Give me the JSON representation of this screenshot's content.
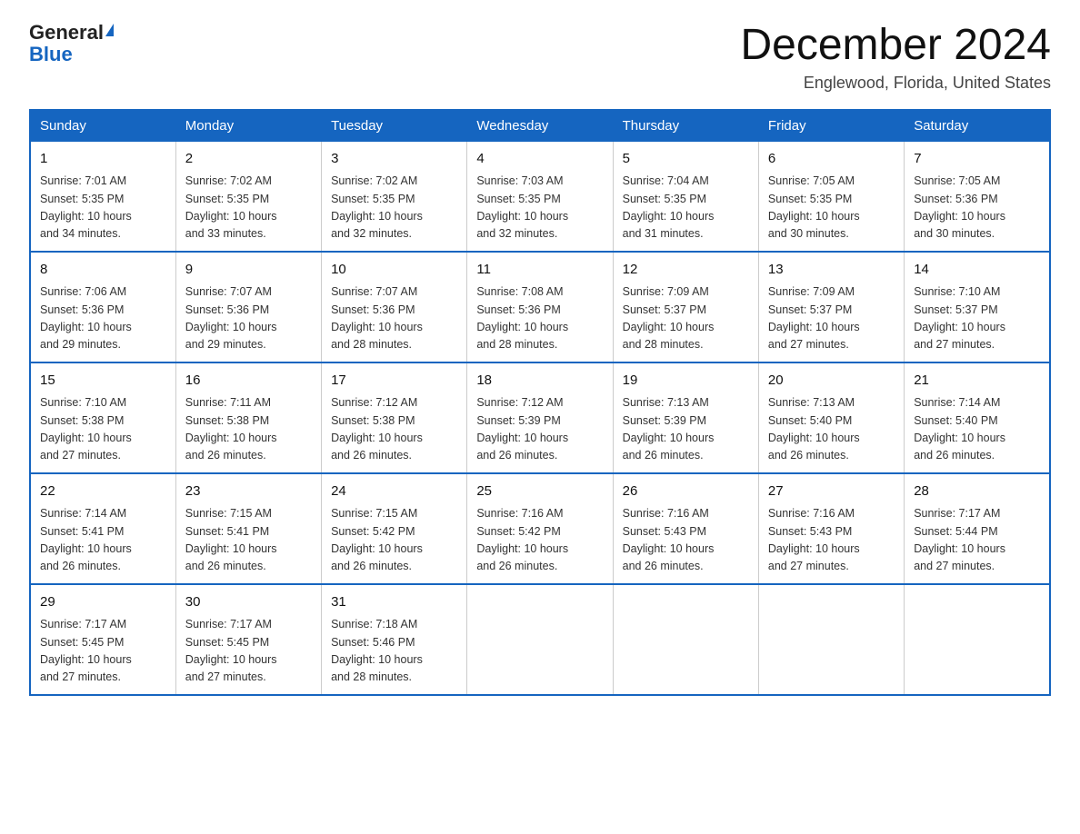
{
  "logo": {
    "general": "General",
    "blue": "Blue"
  },
  "title": "December 2024",
  "subtitle": "Englewood, Florida, United States",
  "weekdays": [
    "Sunday",
    "Monday",
    "Tuesday",
    "Wednesday",
    "Thursday",
    "Friday",
    "Saturday"
  ],
  "weeks": [
    [
      {
        "day": "1",
        "sunrise": "7:01 AM",
        "sunset": "5:35 PM",
        "daylight": "10 hours and 34 minutes."
      },
      {
        "day": "2",
        "sunrise": "7:02 AM",
        "sunset": "5:35 PM",
        "daylight": "10 hours and 33 minutes."
      },
      {
        "day": "3",
        "sunrise": "7:02 AM",
        "sunset": "5:35 PM",
        "daylight": "10 hours and 32 minutes."
      },
      {
        "day": "4",
        "sunrise": "7:03 AM",
        "sunset": "5:35 PM",
        "daylight": "10 hours and 32 minutes."
      },
      {
        "day": "5",
        "sunrise": "7:04 AM",
        "sunset": "5:35 PM",
        "daylight": "10 hours and 31 minutes."
      },
      {
        "day": "6",
        "sunrise": "7:05 AM",
        "sunset": "5:35 PM",
        "daylight": "10 hours and 30 minutes."
      },
      {
        "day": "7",
        "sunrise": "7:05 AM",
        "sunset": "5:36 PM",
        "daylight": "10 hours and 30 minutes."
      }
    ],
    [
      {
        "day": "8",
        "sunrise": "7:06 AM",
        "sunset": "5:36 PM",
        "daylight": "10 hours and 29 minutes."
      },
      {
        "day": "9",
        "sunrise": "7:07 AM",
        "sunset": "5:36 PM",
        "daylight": "10 hours and 29 minutes."
      },
      {
        "day": "10",
        "sunrise": "7:07 AM",
        "sunset": "5:36 PM",
        "daylight": "10 hours and 28 minutes."
      },
      {
        "day": "11",
        "sunrise": "7:08 AM",
        "sunset": "5:36 PM",
        "daylight": "10 hours and 28 minutes."
      },
      {
        "day": "12",
        "sunrise": "7:09 AM",
        "sunset": "5:37 PM",
        "daylight": "10 hours and 28 minutes."
      },
      {
        "day": "13",
        "sunrise": "7:09 AM",
        "sunset": "5:37 PM",
        "daylight": "10 hours and 27 minutes."
      },
      {
        "day": "14",
        "sunrise": "7:10 AM",
        "sunset": "5:37 PM",
        "daylight": "10 hours and 27 minutes."
      }
    ],
    [
      {
        "day": "15",
        "sunrise": "7:10 AM",
        "sunset": "5:38 PM",
        "daylight": "10 hours and 27 minutes."
      },
      {
        "day": "16",
        "sunrise": "7:11 AM",
        "sunset": "5:38 PM",
        "daylight": "10 hours and 26 minutes."
      },
      {
        "day": "17",
        "sunrise": "7:12 AM",
        "sunset": "5:38 PM",
        "daylight": "10 hours and 26 minutes."
      },
      {
        "day": "18",
        "sunrise": "7:12 AM",
        "sunset": "5:39 PM",
        "daylight": "10 hours and 26 minutes."
      },
      {
        "day": "19",
        "sunrise": "7:13 AM",
        "sunset": "5:39 PM",
        "daylight": "10 hours and 26 minutes."
      },
      {
        "day": "20",
        "sunrise": "7:13 AM",
        "sunset": "5:40 PM",
        "daylight": "10 hours and 26 minutes."
      },
      {
        "day": "21",
        "sunrise": "7:14 AM",
        "sunset": "5:40 PM",
        "daylight": "10 hours and 26 minutes."
      }
    ],
    [
      {
        "day": "22",
        "sunrise": "7:14 AM",
        "sunset": "5:41 PM",
        "daylight": "10 hours and 26 minutes."
      },
      {
        "day": "23",
        "sunrise": "7:15 AM",
        "sunset": "5:41 PM",
        "daylight": "10 hours and 26 minutes."
      },
      {
        "day": "24",
        "sunrise": "7:15 AM",
        "sunset": "5:42 PM",
        "daylight": "10 hours and 26 minutes."
      },
      {
        "day": "25",
        "sunrise": "7:16 AM",
        "sunset": "5:42 PM",
        "daylight": "10 hours and 26 minutes."
      },
      {
        "day": "26",
        "sunrise": "7:16 AM",
        "sunset": "5:43 PM",
        "daylight": "10 hours and 26 minutes."
      },
      {
        "day": "27",
        "sunrise": "7:16 AM",
        "sunset": "5:43 PM",
        "daylight": "10 hours and 27 minutes."
      },
      {
        "day": "28",
        "sunrise": "7:17 AM",
        "sunset": "5:44 PM",
        "daylight": "10 hours and 27 minutes."
      }
    ],
    [
      {
        "day": "29",
        "sunrise": "7:17 AM",
        "sunset": "5:45 PM",
        "daylight": "10 hours and 27 minutes."
      },
      {
        "day": "30",
        "sunrise": "7:17 AM",
        "sunset": "5:45 PM",
        "daylight": "10 hours and 27 minutes."
      },
      {
        "day": "31",
        "sunrise": "7:18 AM",
        "sunset": "5:46 PM",
        "daylight": "10 hours and 28 minutes."
      },
      null,
      null,
      null,
      null
    ]
  ],
  "labels": {
    "sunrise": "Sunrise:",
    "sunset": "Sunset:",
    "daylight": "Daylight:"
  }
}
